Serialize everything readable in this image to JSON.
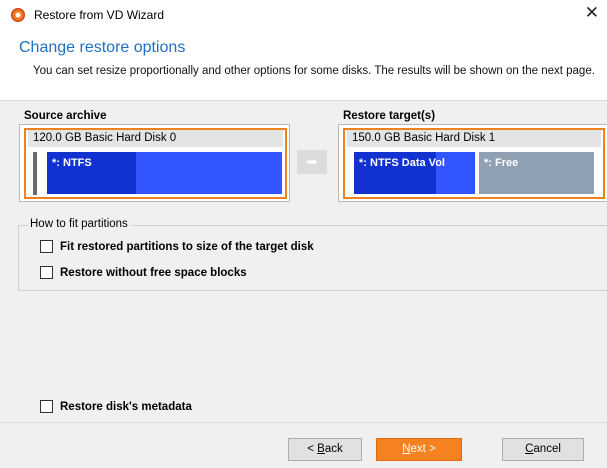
{
  "window": {
    "title": "Restore from VD Wizard",
    "close_glyph": "✕"
  },
  "header": {
    "heading": "Change restore options",
    "description": "You can set resize proportionally and other options for some disks. The results will be shown on the next page."
  },
  "source": {
    "label": "Source archive",
    "disk_title": "120.0 GB  Basic Hard Disk 0",
    "partitions": [
      {
        "label": "*: NTFS",
        "fill": 0.38
      }
    ]
  },
  "arrow": {
    "glyph": "➡"
  },
  "target": {
    "label": "Restore target(s)",
    "disk_title": "150.0 GB  Basic Hard Disk 1",
    "partitions": [
      {
        "label": "*: NTFS Data Vol",
        "fill": 0.68
      },
      {
        "label": "*: Free"
      }
    ]
  },
  "fit_group": {
    "title": "How to fit partitions",
    "options": [
      {
        "label": "Fit restored partitions to size of the target disk",
        "checked": false
      },
      {
        "label": "Restore without free space blocks",
        "checked": false
      }
    ]
  },
  "metadata_option": {
    "label": "Restore disk's metadata",
    "checked": false
  },
  "buttons": {
    "back_pre": "< ",
    "back_key": "B",
    "back_post": "ack",
    "next_key": "N",
    "next_post": "ext >",
    "cancel_key": "C",
    "cancel_post": "ancel"
  },
  "colors": {
    "accent_orange": "#f58220",
    "heading_blue": "#1f6fc5",
    "ntfs_fill": "#1131d0",
    "ntfs_bg": "#3355ff",
    "free_bg": "#8fa0b3"
  }
}
